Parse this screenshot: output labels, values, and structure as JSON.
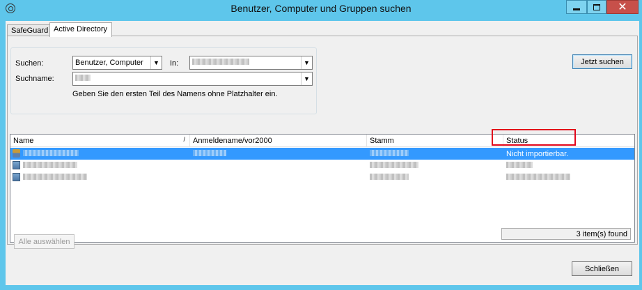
{
  "window": {
    "title": "Benutzer, Computer und Gruppen suchen"
  },
  "tabs": [
    {
      "label": "SafeGuard"
    },
    {
      "label": "Active Directory"
    }
  ],
  "search": {
    "suchen_label": "Suchen:",
    "suchen_value": "Benutzer, Computer",
    "in_label": "In:",
    "name_label": "Suchname:",
    "hint": "Geben Sie den ersten Teil des Namens ohne Platzhalter ein.",
    "search_button": "Jetzt suchen"
  },
  "table": {
    "columns": [
      "Name",
      "Anmeldename/vor2000",
      "Stamm",
      "Status"
    ],
    "rows": [
      {
        "type": "user",
        "status": "Nicht importierbar.",
        "selected": true
      },
      {
        "type": "computer",
        "status": ""
      },
      {
        "type": "computer",
        "status": ""
      }
    ],
    "found_text": "3 item(s) found"
  },
  "buttons": {
    "select_all": "Alle auswählen",
    "close": "Schließen"
  },
  "colors": {
    "titlebar": "#5ec6eb",
    "selection": "#3399ff",
    "highlight_box": "#e2061b"
  },
  "icons": {
    "app": "gear-icon",
    "user_row": "user-icon",
    "computer_row": "computer-icon"
  }
}
